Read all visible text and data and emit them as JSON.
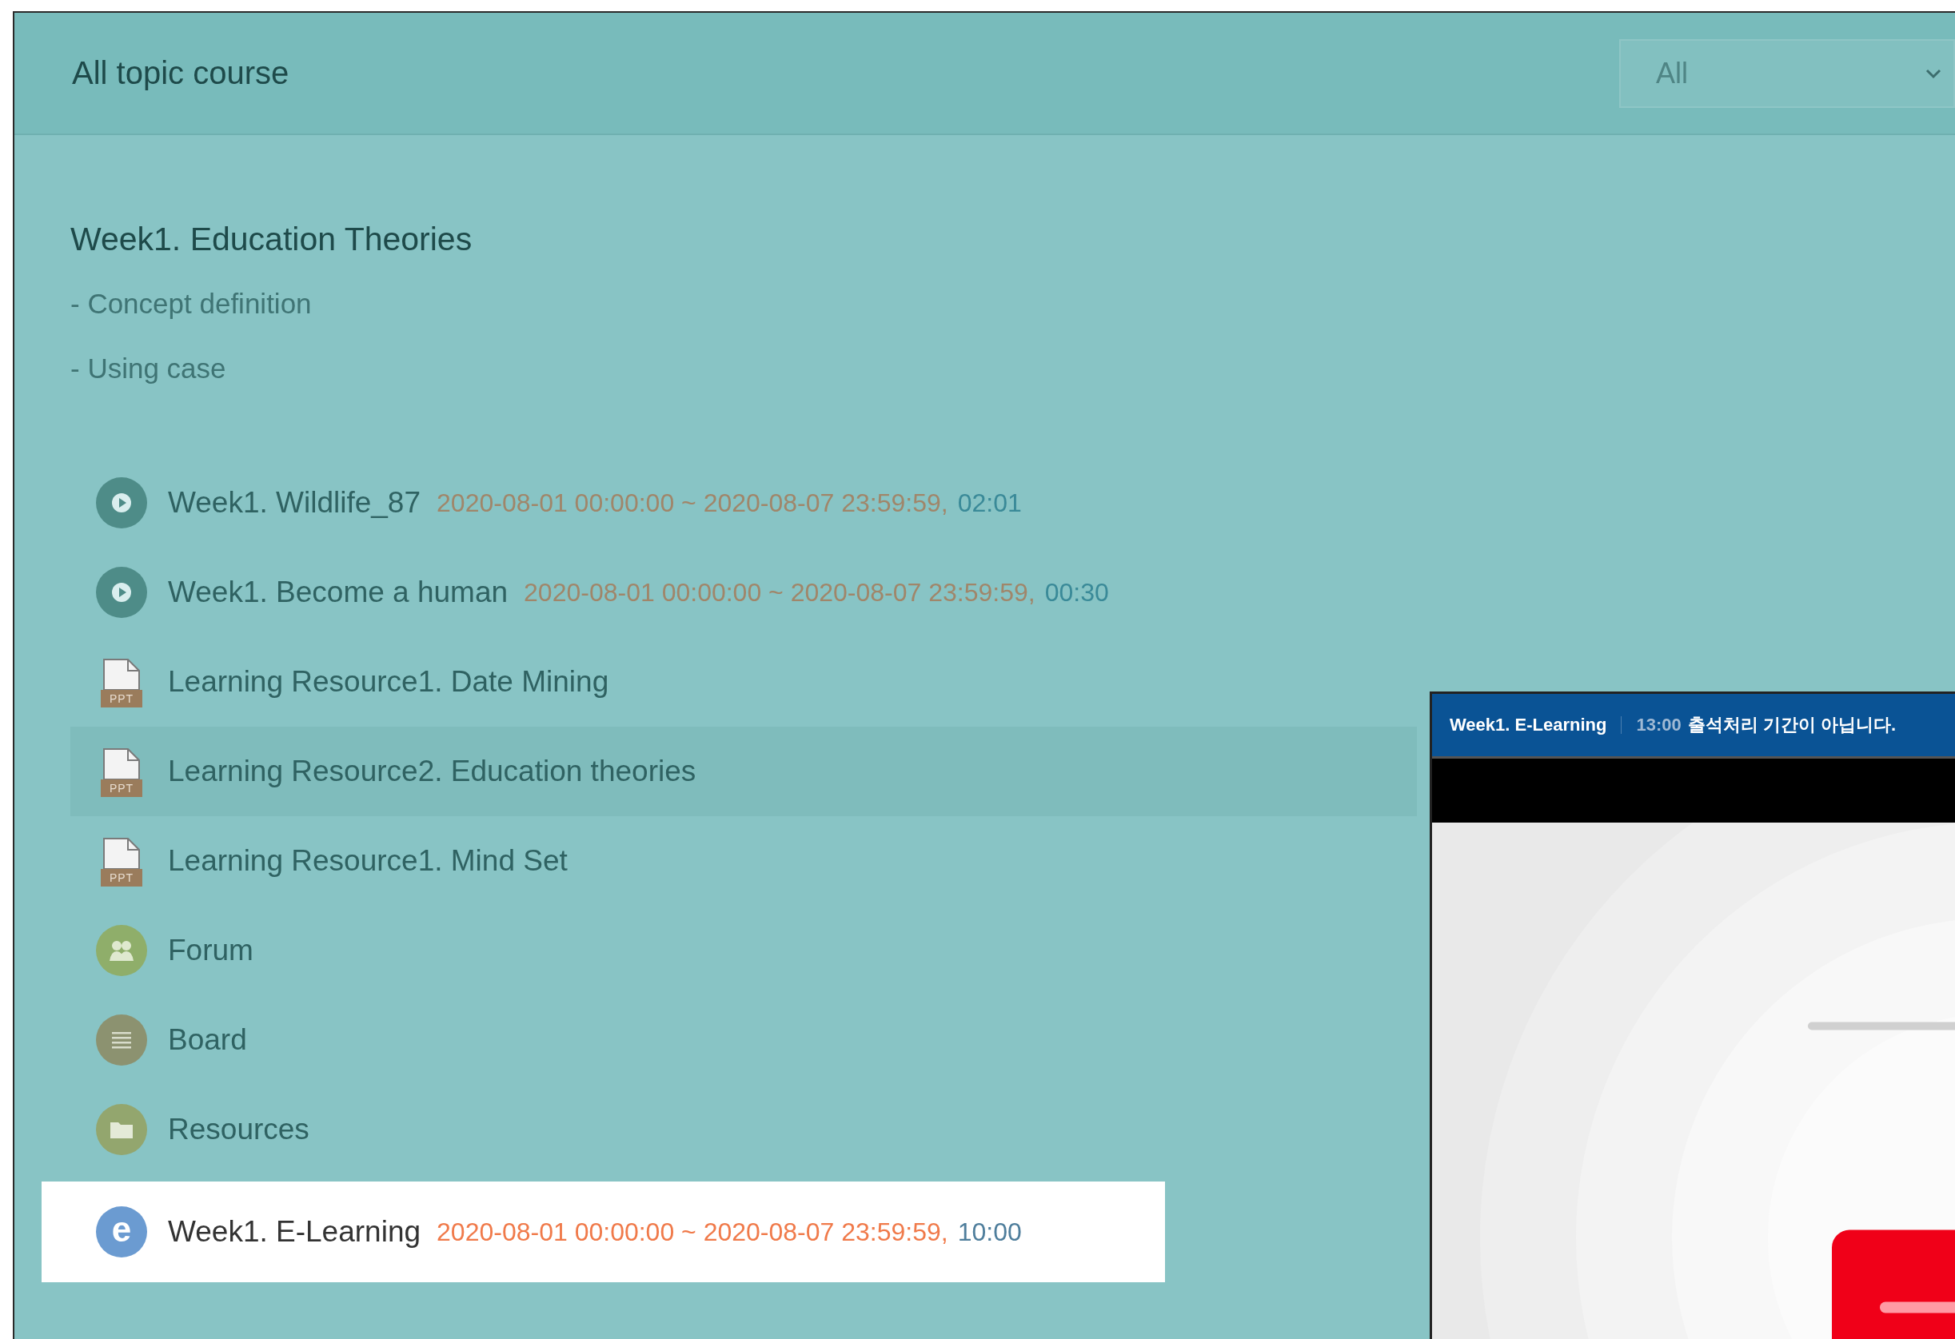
{
  "header": {
    "title": "All topic course",
    "filter": {
      "value": "All"
    }
  },
  "section": {
    "title": "Week1. Education Theories",
    "topics": [
      "- Concept definition",
      "- Using case"
    ]
  },
  "activities": [
    {
      "kind": "video",
      "title": "Week1. Wildlife_87",
      "period": "2020-08-01 00:00:00 ~ 2020-08-07 23:59:59,",
      "duration": "02:01",
      "hovered": false,
      "spotlighted": false
    },
    {
      "kind": "video",
      "title": "Week1. Become a human",
      "period": "2020-08-01 00:00:00 ~ 2020-08-07 23:59:59,",
      "duration": "00:30",
      "hovered": false,
      "spotlighted": false
    },
    {
      "kind": "file",
      "badge": "PPT",
      "title": "Learning Resource1. Date Mining",
      "hovered": false,
      "spotlighted": false
    },
    {
      "kind": "file",
      "badge": "PPT",
      "title": "Learning Resource2. Education theories",
      "hovered": true,
      "spotlighted": false
    },
    {
      "kind": "file",
      "badge": "PPT",
      "title": "Learning Resource1. Mind Set",
      "hovered": false,
      "spotlighted": false
    },
    {
      "kind": "forum",
      "title": "Forum",
      "hovered": false,
      "spotlighted": false
    },
    {
      "kind": "board",
      "title": "Board",
      "hovered": false,
      "spotlighted": false
    },
    {
      "kind": "folder",
      "title": "Resources",
      "hovered": false,
      "spotlighted": false
    },
    {
      "kind": "elearning",
      "badge": "e",
      "title": "Week1. E-Learning",
      "period": "2020-08-01 00:00:00 ~ 2020-08-07 23:59:59,",
      "duration": "10:00",
      "hovered": false,
      "spotlighted": true
    }
  ],
  "player": {
    "title": "Week1. E-Learning",
    "time": "13:00",
    "message": "출석처리 기간이 아닙니다."
  }
}
